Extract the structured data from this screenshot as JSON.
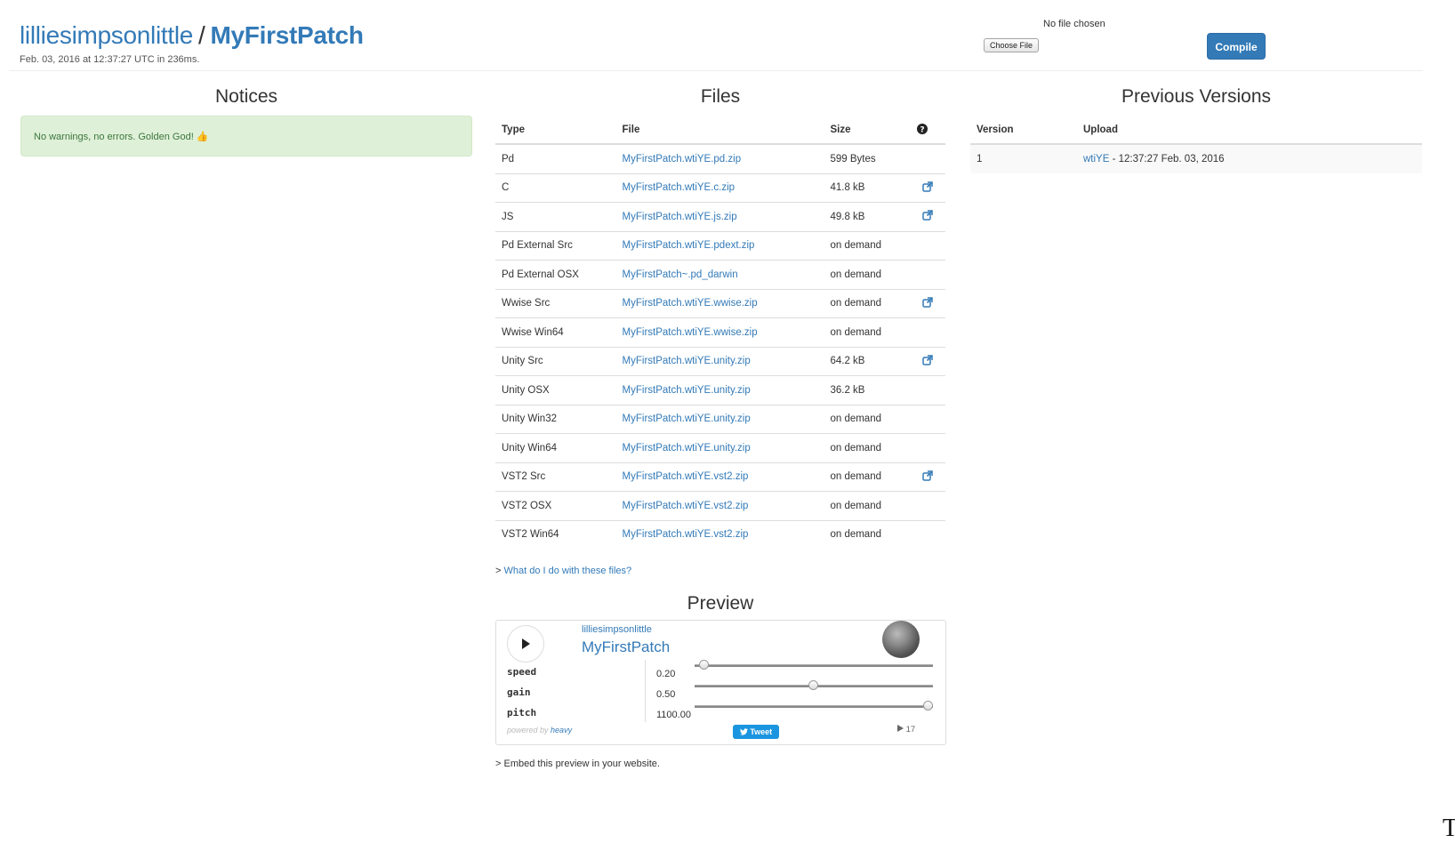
{
  "header": {
    "user": "lilliesimpsonlittle",
    "separator": "/",
    "patch": "MyFirstPatch",
    "subtitle": "Feb. 03, 2016 at 12:37:27 UTC in 236ms.",
    "file_status": "No file chosen",
    "choose_file_label": "Choose File",
    "compile_label": "Compile"
  },
  "notices": {
    "title": "Notices",
    "message": "No warnings, no errors. Golden God! 👍"
  },
  "files": {
    "title": "Files",
    "columns": [
      "Type",
      "File",
      "Size"
    ],
    "help_icon": "question-circle-icon",
    "rows": [
      {
        "type": "Pd",
        "file": "MyFirstPatch.wtiYE.pd.zip",
        "size": "599 Bytes",
        "ext": false
      },
      {
        "type": "C",
        "file": "MyFirstPatch.wtiYE.c.zip",
        "size": "41.8 kB",
        "ext": true
      },
      {
        "type": "JS",
        "file": "MyFirstPatch.wtiYE.js.zip",
        "size": "49.8 kB",
        "ext": true
      },
      {
        "type": "Pd External Src",
        "file": "MyFirstPatch.wtiYE.pdext.zip",
        "size": "on demand",
        "ext": false
      },
      {
        "type": "Pd External OSX",
        "file": "MyFirstPatch~.pd_darwin",
        "size": "on demand",
        "ext": false
      },
      {
        "type": "Wwise Src",
        "file": "MyFirstPatch.wtiYE.wwise.zip",
        "size": "on demand",
        "ext": true
      },
      {
        "type": "Wwise Win64",
        "file": "MyFirstPatch.wtiYE.wwise.zip",
        "size": "on demand",
        "ext": false
      },
      {
        "type": "Unity Src",
        "file": "MyFirstPatch.wtiYE.unity.zip",
        "size": "64.2 kB",
        "ext": true
      },
      {
        "type": "Unity OSX",
        "file": "MyFirstPatch.wtiYE.unity.zip",
        "size": "36.2 kB",
        "ext": false
      },
      {
        "type": "Unity Win32",
        "file": "MyFirstPatch.wtiYE.unity.zip",
        "size": "on demand",
        "ext": false
      },
      {
        "type": "Unity Win64",
        "file": "MyFirstPatch.wtiYE.unity.zip",
        "size": "on demand",
        "ext": false
      },
      {
        "type": "VST2 Src",
        "file": "MyFirstPatch.wtiYE.vst2.zip",
        "size": "on demand",
        "ext": true
      },
      {
        "type": "VST2 OSX",
        "file": "MyFirstPatch.wtiYE.vst2.zip",
        "size": "on demand",
        "ext": false
      },
      {
        "type": "VST2 Win64",
        "file": "MyFirstPatch.wtiYE.vst2.zip",
        "size": "on demand",
        "ext": false
      }
    ],
    "help_prefix": "> ",
    "help_link": "What do I do with these files?"
  },
  "preview": {
    "title": "Preview",
    "user": "lilliesimpsonlittle",
    "patch": "MyFirstPatch",
    "params": [
      {
        "name": "speed",
        "value": "0.20",
        "level": 0.04
      },
      {
        "name": "gain",
        "value": "0.50",
        "level": 0.5
      },
      {
        "name": "pitch",
        "value": "1100.00",
        "level": 0.98
      }
    ],
    "powered_by": "powered by",
    "powered_brand": "heavy",
    "tweet_label": "Tweet",
    "play_count": "17",
    "embed_text": "> Embed this preview in your website."
  },
  "versions": {
    "title": "Previous Versions",
    "columns": [
      "Version",
      "Upload"
    ],
    "rows": [
      {
        "version": "1",
        "link": "wtiYE",
        "detail": " - 12:37:27 Feb. 03, 2016"
      }
    ]
  },
  "colors": {
    "link": "#337ab7",
    "success_bg": "#dff0d8",
    "success_text": "#3c763d",
    "tweet": "#1b95e0"
  },
  "misc": {
    "corner_glyph": "T"
  }
}
